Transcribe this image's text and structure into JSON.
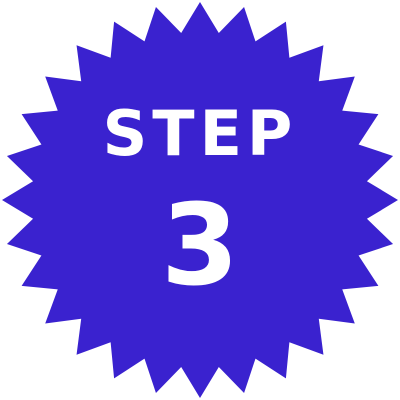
{
  "badge": {
    "title": "STEP",
    "number": "3",
    "fill_color": "#3a22cf",
    "text_color": "#ffffff",
    "shape_icon": "starburst-badge"
  }
}
